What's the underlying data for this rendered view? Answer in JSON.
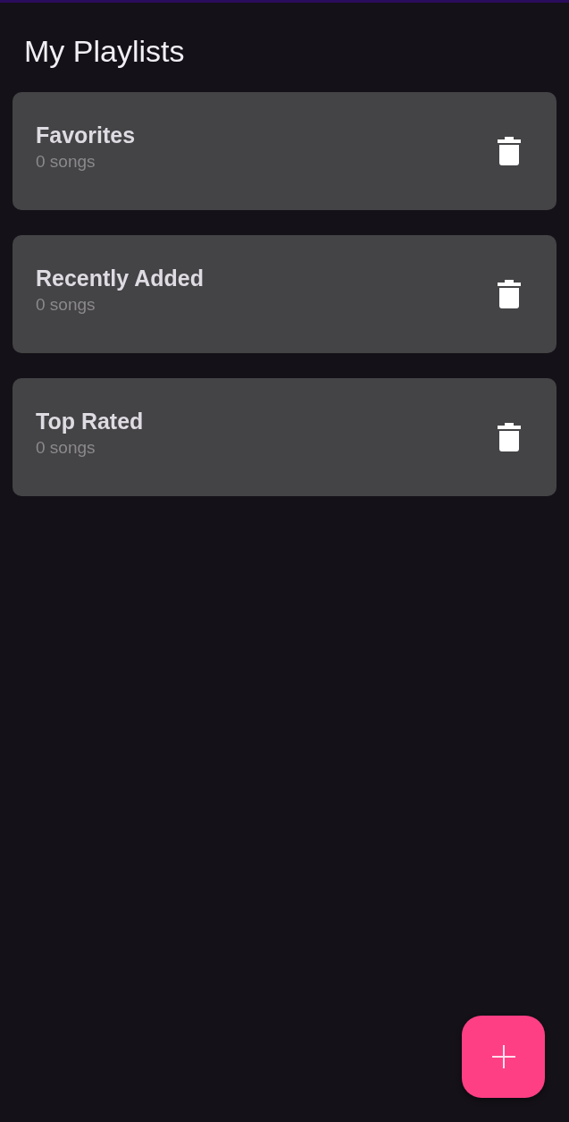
{
  "title": "My Playlists",
  "playlists": [
    {
      "name": "Favorites",
      "count": "0 songs"
    },
    {
      "name": "Recently Added",
      "count": "0 songs"
    },
    {
      "name": "Top Rated",
      "count": "0 songs"
    }
  ]
}
